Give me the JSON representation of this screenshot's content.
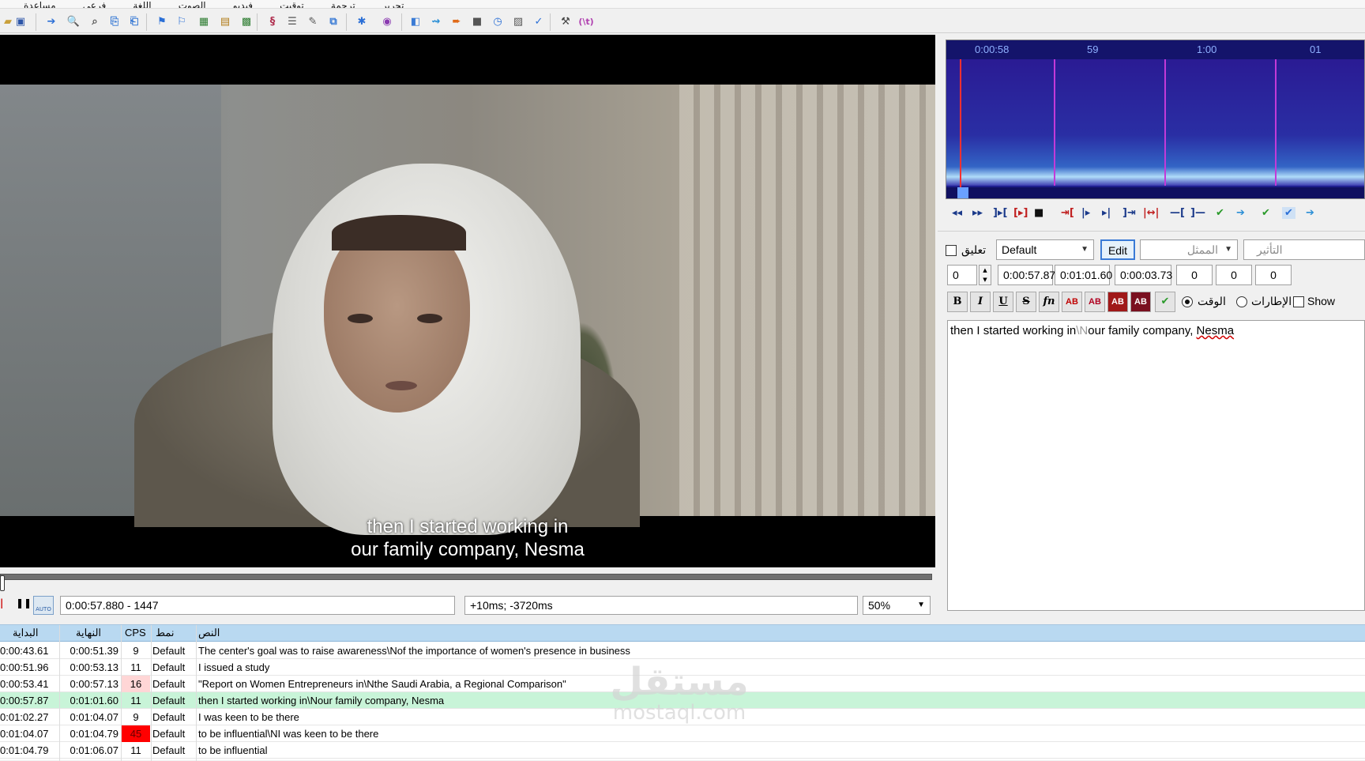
{
  "menu": [
    "مساعدة",
    "فرعي",
    "اللغة",
    "الصوت",
    "فيديو",
    "توقيت",
    "ترجمة",
    "تحرير"
  ],
  "video": {
    "subtitle_line1": "then I started working in",
    "subtitle_line2": "our family company, Nesma"
  },
  "player": {
    "time_display": "0:00:57.880 - 1447",
    "offset_display": "+10ms; -3720ms",
    "zoom": "50%"
  },
  "audio": {
    "tick_labels": [
      "0:00:58",
      "59",
      "1:00",
      "01"
    ]
  },
  "props": {
    "comment_label": "تعليق",
    "style_value": "Default",
    "edit_label": "Edit",
    "actor_placeholder": "الممثل",
    "effect_placeholder": "التأثير",
    "layer": "0",
    "start": "0:00:57.87",
    "end": "0:01:01.60",
    "duration": "0:00:03.73",
    "margin_l": "0",
    "margin_r": "0",
    "margin_v": "0",
    "time_label": "الوقت",
    "frames_label": "الإطارات",
    "show_label": "Show",
    "bold": "B",
    "italic": "I",
    "underline": "U",
    "strike": "S",
    "fn": "fn",
    "ab": "AB",
    "text_part1": "then I started working in",
    "text_nl": "\\N",
    "text_part2": "our family company, ",
    "text_name": "Nesma"
  },
  "grid": {
    "headers": {
      "start": "البداية",
      "end": "النهاية",
      "cps": "CPS",
      "style": "نمط",
      "text": "النص"
    },
    "rows": [
      {
        "start": "0:00:43.61",
        "end": "0:00:51.39",
        "cps": "9",
        "style": "Default",
        "text": "The center's goal was to raise awareness\\Nof the importance of women's presence in business",
        "flag": ""
      },
      {
        "start": "0:00:51.96",
        "end": "0:00:53.13",
        "cps": "11",
        "style": "Default",
        "text": "I issued a study",
        "flag": ""
      },
      {
        "start": "0:00:53.41",
        "end": "0:00:57.13",
        "cps": "16",
        "style": "Default",
        "text": "\"Report on Women Entrepreneurs in\\Nthe Saudi Arabia, a Regional Comparison\"",
        "flag": "warn"
      },
      {
        "start": "0:00:57.87",
        "end": "0:01:01.60",
        "cps": "11",
        "style": "Default",
        "text": "then I started working in\\Nour family company, Nesma",
        "flag": "sel"
      },
      {
        "start": "0:01:02.27",
        "end": "0:01:04.07",
        "cps": "9",
        "style": "Default",
        "text": "I was keen to be there",
        "flag": ""
      },
      {
        "start": "0:01:04.07",
        "end": "0:01:04.79",
        "cps": "45",
        "style": "Default",
        "text": "to be influential\\NI was keen to be there",
        "flag": "bad"
      },
      {
        "start": "0:01:04.79",
        "end": "0:01:06.07",
        "cps": "11",
        "style": "Default",
        "text": "to be influential",
        "flag": ""
      }
    ]
  },
  "watermark": {
    "ar": "مستقل",
    "en": "mostaql.com"
  },
  "colors": {
    "selected_row": "#c8f4d8",
    "cps_bad": "#ff0000",
    "cps_warn": "#ffd6d6",
    "header": "#b9d9f1"
  }
}
